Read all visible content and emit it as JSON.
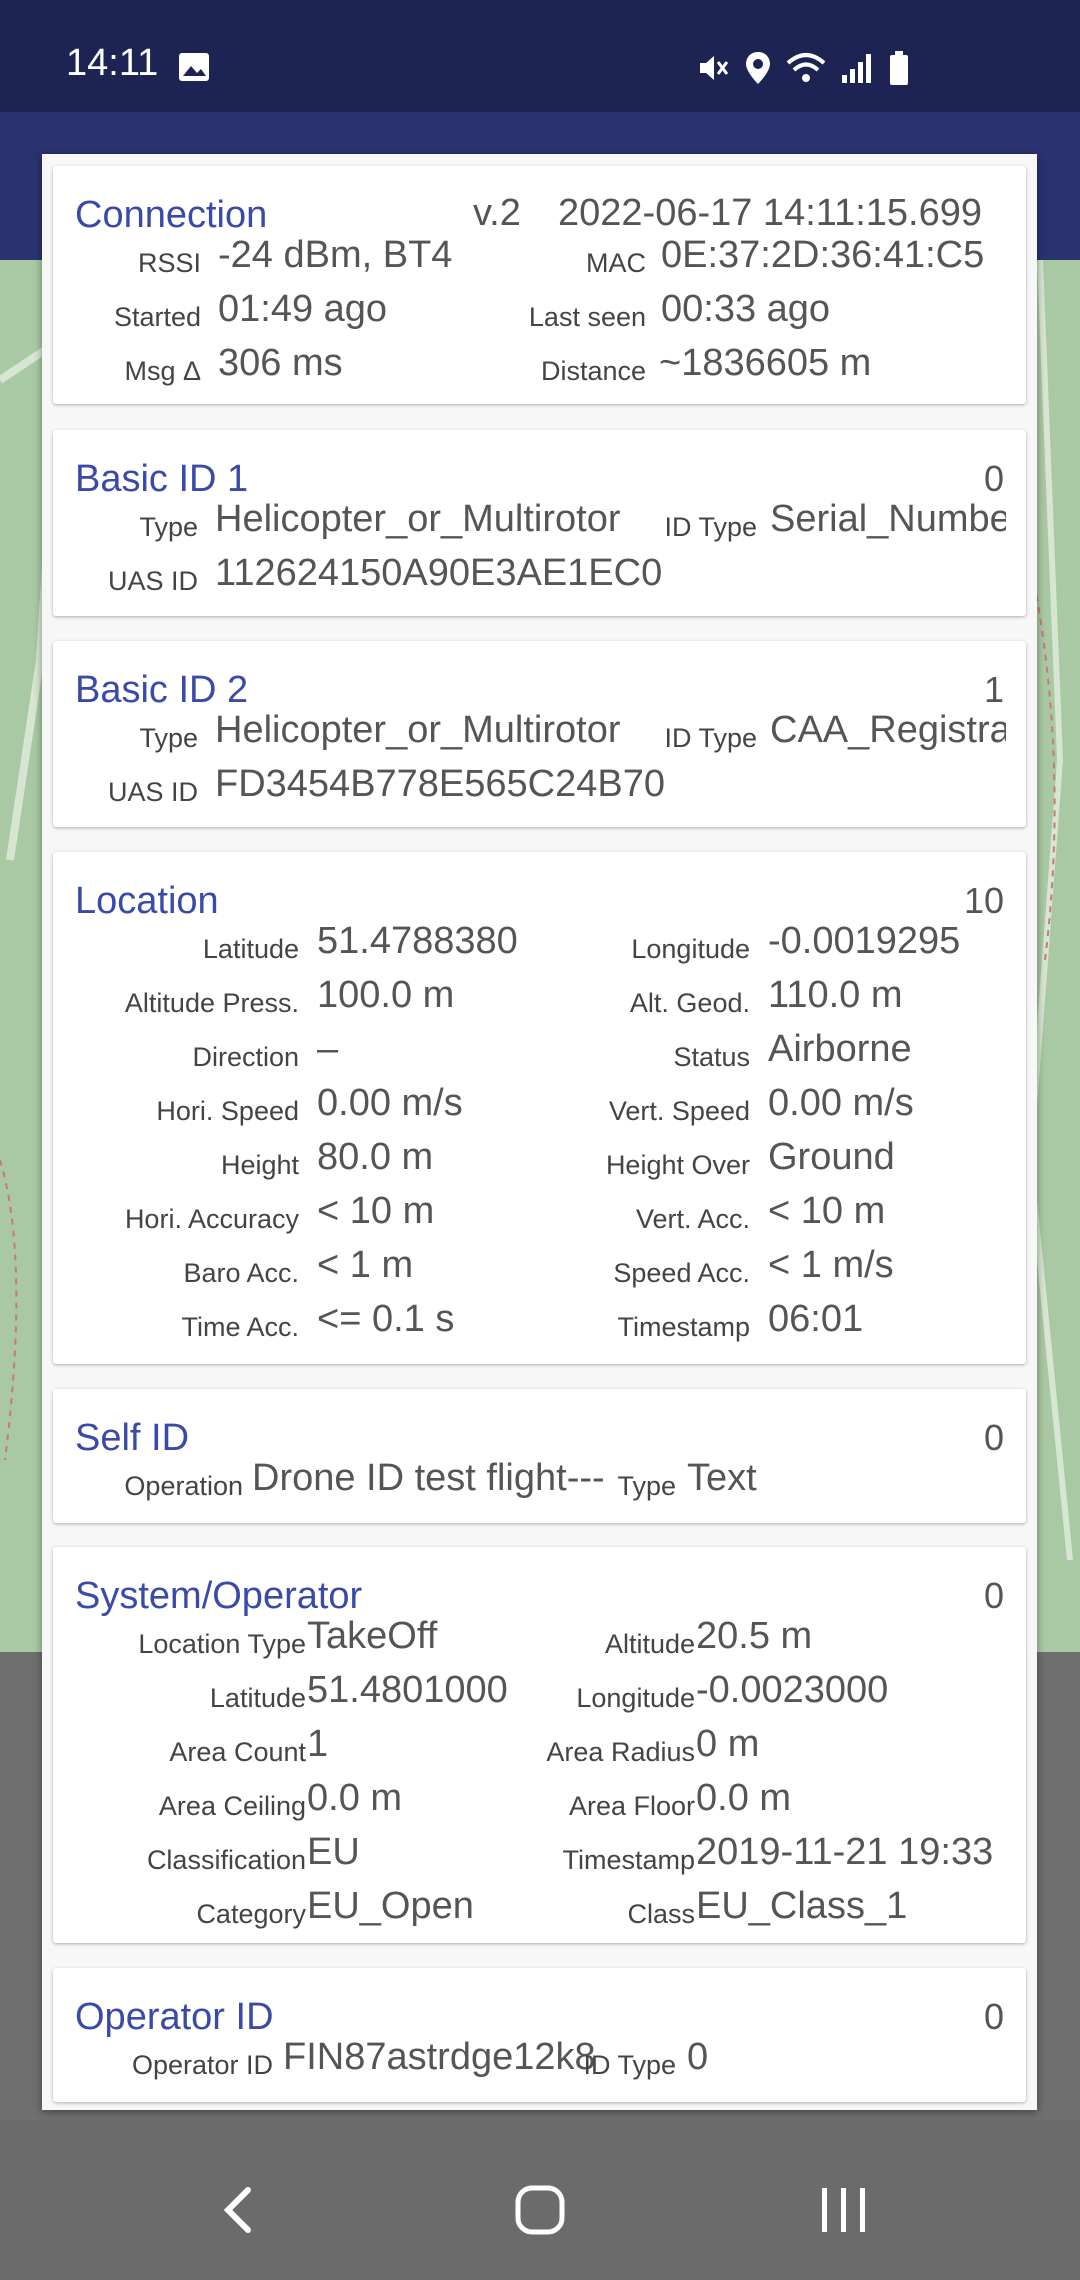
{
  "status_bar": {
    "time": "14:11"
  },
  "connection": {
    "title": "Connection",
    "version": "v.2",
    "timestamp": "2022-06-17 14:11:15.699",
    "rssi_label": "RSSI",
    "rssi": "-24 dBm, BT4",
    "mac_label": "MAC",
    "mac": "0E:37:2D:36:41:C5",
    "started_label": "Started",
    "started": "01:49  ago",
    "last_seen_label": "Last seen",
    "last_seen": "00:33  ago",
    "msg_label": "Msg Δ",
    "msg": "306 ms",
    "distance_label": "Distance",
    "distance": "~1836605 m"
  },
  "basic_id_1": {
    "title": "Basic ID 1",
    "count": "0",
    "type_label": "Type",
    "type": "Helicopter_or_Multirotor",
    "id_type_label": "ID Type",
    "id_type": "Serial_Numbe",
    "uas_id_label": "UAS ID",
    "uas_id": "112624150A90E3AE1EC0"
  },
  "basic_id_2": {
    "title": "Basic ID 2",
    "count": "1",
    "type_label": "Type",
    "type": "Helicopter_or_Multirotor",
    "id_type_label": "ID Type",
    "id_type": "CAA_Registra",
    "uas_id_label": "UAS ID",
    "uas_id": "FD3454B778E565C24B70"
  },
  "location": {
    "title": "Location",
    "count": "10",
    "rows": [
      {
        "l1": "Latitude",
        "v1": "51.4788380",
        "l2": "Longitude",
        "v2": "-0.0019295"
      },
      {
        "l1": "Altitude Press.",
        "v1": "100.0 m",
        "l2": "Alt. Geod.",
        "v2": "110.0 m"
      },
      {
        "l1": "Direction",
        "v1": "–",
        "l2": "Status",
        "v2": "Airborne"
      },
      {
        "l1": "Hori. Speed",
        "v1": "0.00 m/s",
        "l2": "Vert. Speed",
        "v2": "0.00 m/s"
      },
      {
        "l1": "Height",
        "v1": "80.0 m",
        "l2": "Height Over",
        "v2": "Ground"
      },
      {
        "l1": "Hori. Accuracy",
        "v1": "< 10 m",
        "l2": "Vert. Acc.",
        "v2": "< 10 m"
      },
      {
        "l1": "Baro Acc.",
        "v1": "< 1 m",
        "l2": "Speed Acc.",
        "v2": "< 1 m/s"
      },
      {
        "l1": "Time Acc.",
        "v1": "<= 0.1 s",
        "l2": "Timestamp",
        "v2": "06:01"
      }
    ]
  },
  "self_id": {
    "title": "Self ID",
    "count": "0",
    "operation_label": "Operation",
    "operation": "Drone ID test flight---",
    "type_label": "Type",
    "type": "Text"
  },
  "system_operator": {
    "title": "System/Operator",
    "count": "0",
    "rows": [
      {
        "l1": "Location Type",
        "v1": "TakeOff",
        "l2": "Altitude",
        "v2": "20.5 m"
      },
      {
        "l1": "Latitude",
        "v1": "51.4801000",
        "l2": "Longitude",
        "v2": "-0.0023000"
      },
      {
        "l1": "Area Count",
        "v1": "1",
        "l2": "Area Radius",
        "v2": "0 m"
      },
      {
        "l1": "Area Ceiling",
        "v1": "0.0 m",
        "l2": "Area Floor",
        "v2": "0.0 m"
      },
      {
        "l1": "Classification",
        "v1": "EU",
        "l2": "Timestamp",
        "v2": "2019-11-21 19:33"
      },
      {
        "l1": "Category",
        "v1": "EU_Open",
        "l2": "Class",
        "v2": "EU_Class_1"
      }
    ]
  },
  "operator_id": {
    "title": "Operator ID",
    "count": "0",
    "operator_id_label": "Operator ID",
    "operator_id": "FIN87astrdge12k8",
    "id_type_label": "ID Type",
    "id_type": "0"
  }
}
